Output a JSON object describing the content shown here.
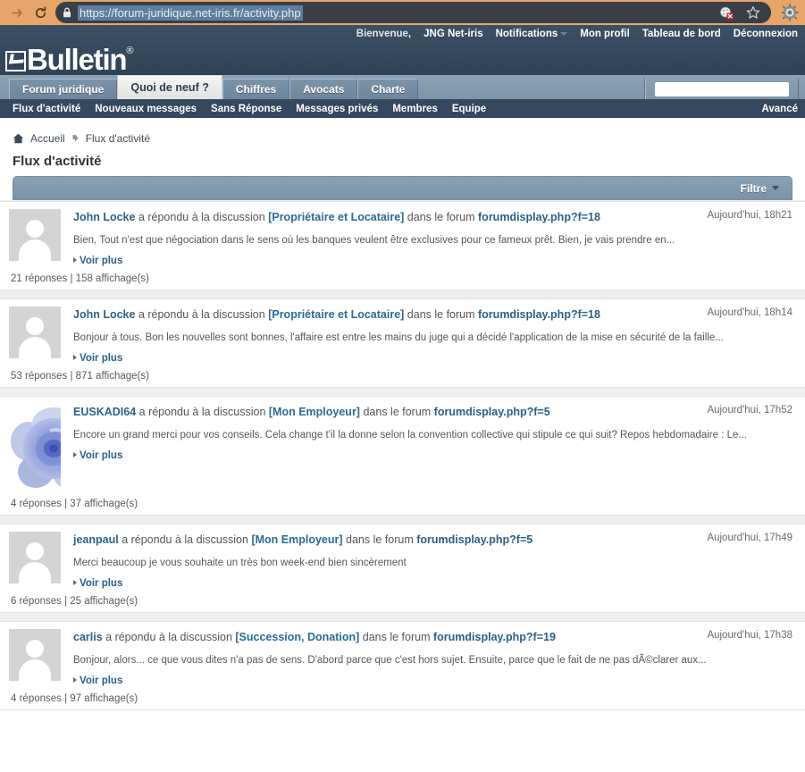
{
  "browser": {
    "url": "https://forum-juridique.net-iris.fr/activity.php",
    "forward_icon": "forward-arrow-icon",
    "reload_icon": "reload-icon",
    "lock_icon": "lock-icon",
    "extension_icon": "cookie-blocked-icon",
    "bookmark_icon": "star-icon",
    "menu_icon": "gear-icon",
    "address_bg": "#3a3f47",
    "chrome_bg": "#e8a56a"
  },
  "header": {
    "logo_text": "Bulletin",
    "logo_registered": "®",
    "bg": "#34495e",
    "usernav": {
      "greeting": "Bienvenue,",
      "username": "JNG Net-iris",
      "items": [
        {
          "label": "Notifications",
          "has_caret": true
        },
        {
          "label": "Mon profil",
          "has_caret": false
        },
        {
          "label": "Tableau de bord",
          "has_caret": false
        },
        {
          "label": "Déconnexion",
          "has_caret": false
        }
      ]
    }
  },
  "tabs": [
    {
      "label": "Forum juridique",
      "active": false
    },
    {
      "label": "Quoi de neuf ?",
      "active": true
    },
    {
      "label": "Chiffres",
      "active": false
    },
    {
      "label": "Avocats",
      "active": false
    },
    {
      "label": "Charte",
      "active": false
    }
  ],
  "search": {
    "value": "",
    "placeholder": ""
  },
  "subnav": {
    "items": [
      "Flux d'activité",
      "Nouveaux messages",
      "Sans Réponse",
      "Messages privés",
      "Membres",
      "Equipe"
    ],
    "advanced_label": "Avancé"
  },
  "breadcrumb": {
    "home_icon": "home-icon",
    "home_label": "Accueil",
    "separator_icon": "breadcrumb-arrow-icon",
    "current": "Flux d'activité"
  },
  "page_title": "Flux d'activité",
  "filter": {
    "label": "Filtre",
    "caret_icon": "chevron-down-icon"
  },
  "entries": [
    {
      "avatar": "default",
      "user": "John Locke",
      "action": " a répondu à la discussion ",
      "thread": "[Propriétaire et Locataire]",
      "mid": " dans le forum ",
      "forum": "forumdisplay.php?f=18",
      "time": "Aujourd'hui, 18h21",
      "snippet": "Bien, Tout n'est que négociation dans le sens où les banques veulent être exclusives pour ce fameux prêt. Bien, je vais prendre en...",
      "more_label": "Voir plus",
      "stats": "21 réponses | 158 affichage(s)"
    },
    {
      "avatar": "default",
      "user": "John Locke",
      "action": " a répondu à la discussion ",
      "thread": "[Propriétaire et Locataire]",
      "mid": " dans le forum ",
      "forum": "forumdisplay.php?f=18",
      "time": "Aujourd'hui, 18h14",
      "snippet": "Bonjour à tous. Bon les nouvelles sont bonnes, l'affaire est entre les mains du juge qui a décidé l'application de la mise en sécurité de la faille...",
      "more_label": "Voir plus",
      "stats": "53 réponses | 871 affichage(s)"
    },
    {
      "avatar": "rose",
      "user": "EUSKADI64",
      "action": " a répondu à la discussion ",
      "thread": "[Mon Employeur]",
      "mid": " dans le forum ",
      "forum": "forumdisplay.php?f=5",
      "time": "Aujourd'hui, 17h52",
      "snippet": "Encore un grand merci pour vos conseils. Cela change t'il la donne selon la convention collective qui stipule ce qui suit? Repos hebdomadaire : Le...",
      "more_label": "Voir plus",
      "stats": "4 réponses | 37 affichage(s)"
    },
    {
      "avatar": "default",
      "user": "jeanpaul",
      "action": " a répondu à la discussion ",
      "thread": "[Mon Employeur]",
      "mid": " dans le forum ",
      "forum": "forumdisplay.php?f=5",
      "time": "Aujourd'hui, 17h49",
      "snippet": "Merci beaucoup je vous souhaite un très bon week-end bien sincèrement",
      "more_label": "Voir plus",
      "stats": "6 réponses | 25 affichage(s)"
    },
    {
      "avatar": "default",
      "user": "carlis",
      "action": " a répondu à la discussion ",
      "thread": "[Succession, Donation]",
      "mid": " dans le forum ",
      "forum": "forumdisplay.php?f=19",
      "time": "Aujourd'hui, 17h38",
      "snippet": "Bonjour, alors... ce que vous dites n'a pas de sens. D'abord parce que c'est hors sujet. Ensuite, parce que le fait de ne pas dÃ©clarer aux...",
      "more_label": "Voir plus",
      "stats": "4 réponses | 97 affichage(s)"
    }
  ]
}
